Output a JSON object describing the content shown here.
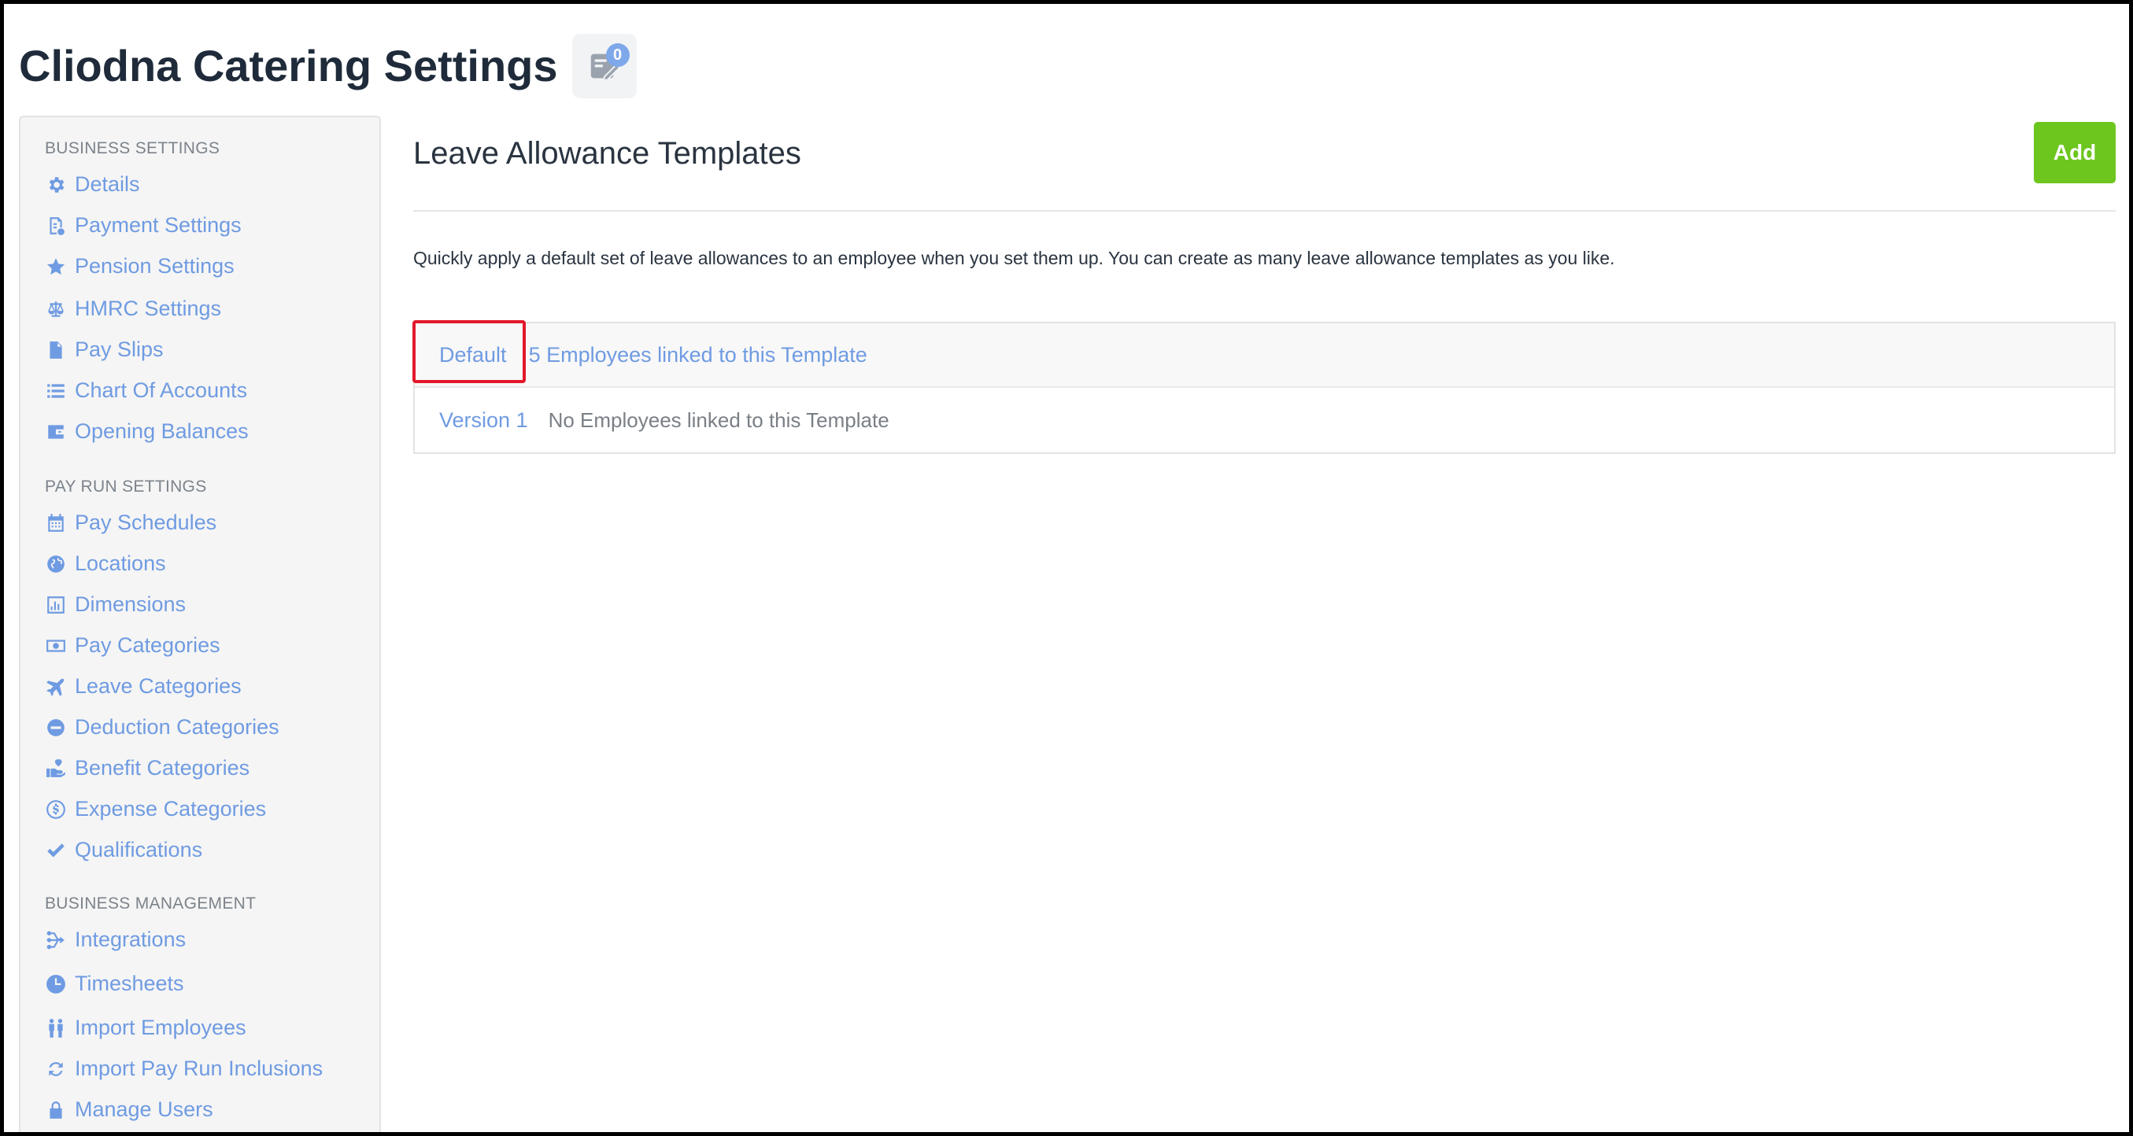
{
  "header": {
    "title": "Cliodna Catering Settings",
    "notification_count": "0",
    "notification_icon": "notes-icon"
  },
  "sidebar": {
    "sections": [
      {
        "title": "BUSINESS SETTINGS",
        "items": [
          {
            "label": "Details",
            "icon": "gear-icon"
          },
          {
            "label": "Payment Settings",
            "icon": "payment-doc-icon"
          },
          {
            "label": "Pension Settings",
            "icon": "star-icon"
          },
          {
            "label": "HMRC Settings",
            "icon": "scales-icon"
          },
          {
            "label": "Pay Slips",
            "icon": "file-icon"
          },
          {
            "label": "Chart Of Accounts",
            "icon": "list-icon"
          },
          {
            "label": "Opening Balances",
            "icon": "wallet-icon"
          }
        ]
      },
      {
        "title": "PAY RUN SETTINGS",
        "items": [
          {
            "label": "Pay Schedules",
            "icon": "calendar-icon"
          },
          {
            "label": "Locations",
            "icon": "globe-icon"
          },
          {
            "label": "Dimensions",
            "icon": "bar-chart-icon"
          },
          {
            "label": "Pay Categories",
            "icon": "money-icon"
          },
          {
            "label": "Leave Categories",
            "icon": "plane-icon"
          },
          {
            "label": "Deduction Categories",
            "icon": "minus-circle-icon"
          },
          {
            "label": "Benefit Categories",
            "icon": "hand-heart-icon"
          },
          {
            "label": "Expense Categories",
            "icon": "dollar-circle-icon"
          },
          {
            "label": "Qualifications",
            "icon": "check-icon"
          }
        ]
      },
      {
        "title": "BUSINESS MANAGEMENT",
        "items": [
          {
            "label": "Integrations",
            "icon": "integrations-icon"
          },
          {
            "label": "Timesheets",
            "icon": "clock-icon"
          },
          {
            "label": "Import Employees",
            "icon": "people-icon"
          },
          {
            "label": "Import Pay Run Inclusions",
            "icon": "refresh-icon"
          },
          {
            "label": "Manage Users",
            "icon": "lock-icon"
          }
        ]
      }
    ]
  },
  "main": {
    "title": "Leave Allowance Templates",
    "add_label": "Add",
    "description": "Quickly apply a default set of leave allowances to an employee when you set them up. You can create as many leave allowance templates as you like.",
    "templates": [
      {
        "name": "Default",
        "linked": "5 Employees linked to this Template"
      },
      {
        "name": "Version 1",
        "linked": "No Employees linked to this Template"
      }
    ]
  },
  "colors": {
    "link": "#6f9be2",
    "add_button": "#6cc61e",
    "highlight": "#e2182a",
    "badge": "#7fa8ea"
  }
}
